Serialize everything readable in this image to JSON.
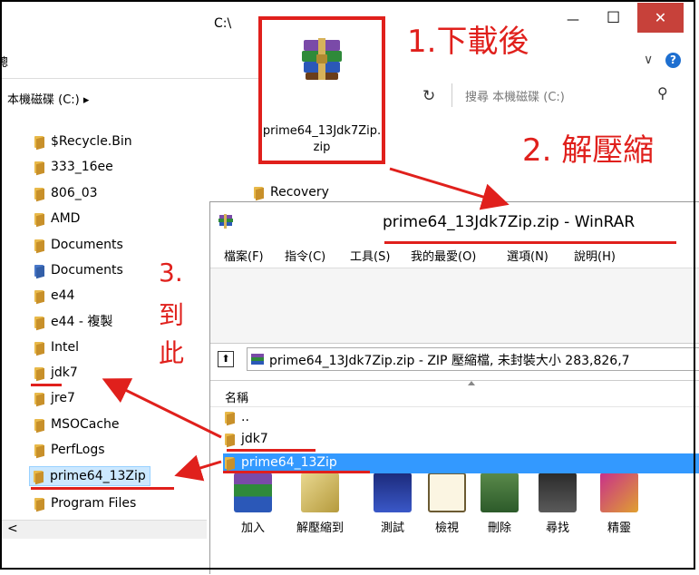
{
  "explorer": {
    "title": "C:\\",
    "breadcrumb": "本機磁碟 (C:) ▸",
    "partial_left_char": "總",
    "search_placeholder": "搜尋 本機磁碟 (C:)",
    "tree": [
      "$Recycle.Bin",
      "333_16ee",
      "806_03",
      "AMD",
      "Documents",
      "Documents",
      "e44",
      "e44 - 複製",
      "Intel",
      "jdk7",
      "jre7",
      "MSOCache",
      "PerfLogs",
      "prime64_13Zip",
      "Program Files"
    ],
    "recovery_label": "Recovery",
    "minimize": "—",
    "maximize": "☐",
    "close": "✕",
    "scroll_left": "<",
    "chevron": "∨",
    "help": "?",
    "refresh": "↻",
    "search_glyph": "⚲"
  },
  "zip_file": {
    "label": "prime64_13Jdk7Zip.zip"
  },
  "annotations": {
    "step1": "1.下載後",
    "step2": "2. 解壓縮",
    "step3_line1": "3.",
    "step3_line2": "到",
    "step3_line3": "此"
  },
  "winrar": {
    "title": "prime64_13Jdk7Zip.zip - WinRAR",
    "menu": [
      "檔案(F)",
      "指令(C)",
      "工具(S)",
      "我的最愛(O)",
      "選項(N)",
      "說明(H)"
    ],
    "toolbar": [
      "加入",
      "解壓縮到",
      "測試",
      "檢視",
      "刪除",
      "尋找",
      "精靈"
    ],
    "up_glyph": "⬆",
    "path": "prime64_13Jdk7Zip.zip - ZIP 壓縮檔, 未封裝大小 283,826,7",
    "column_name": "名稱",
    "files": [
      "..",
      "jdk7",
      "prime64_13Zip"
    ]
  },
  "colors": {
    "annotation_red": "#e0201c",
    "selection": "#3399ff",
    "close_button": "#c7413a"
  }
}
